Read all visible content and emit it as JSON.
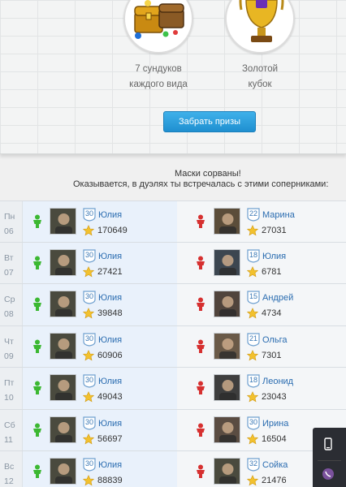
{
  "prizes": {
    "chests": {
      "line1": "7 сундуков",
      "line2": "каждого вида",
      "icon": "treasure-chests-icon"
    },
    "cup": {
      "line1": "Золотой",
      "line2": "кубок",
      "icon": "golden-cup-icon"
    }
  },
  "claim_button": "Забрать призы",
  "message": {
    "title": "Маски сорваны!",
    "subtitle": "Оказывается, в дуэлях ты встречалась с этими соперниками:"
  },
  "colors": {
    "accent_blue": "#2a99dc",
    "name_link": "#2a6cb0",
    "winner_green": "#3cb832",
    "loser_red": "#d63030",
    "star_gold": "#f2c12e"
  },
  "duels": [
    {
      "day": "Пн",
      "date": "06",
      "left": {
        "level": "30",
        "name": "Юлия",
        "score": "170649",
        "result": "win"
      },
      "right": {
        "level": "22",
        "name": "Марина",
        "score": "27031",
        "result": "lose"
      }
    },
    {
      "day": "Вт",
      "date": "07",
      "left": {
        "level": "30",
        "name": "Юлия",
        "score": "27421",
        "result": "win"
      },
      "right": {
        "level": "18",
        "name": "Юлия",
        "score": "6781",
        "result": "lose"
      }
    },
    {
      "day": "Ср",
      "date": "08",
      "left": {
        "level": "30",
        "name": "Юлия",
        "score": "39848",
        "result": "win"
      },
      "right": {
        "level": "15",
        "name": "Андрей",
        "score": "4734",
        "result": "lose"
      }
    },
    {
      "day": "Чт",
      "date": "09",
      "left": {
        "level": "30",
        "name": "Юлия",
        "score": "60906",
        "result": "win"
      },
      "right": {
        "level": "21",
        "name": "Ольга",
        "score": "7301",
        "result": "lose"
      }
    },
    {
      "day": "Пт",
      "date": "10",
      "left": {
        "level": "30",
        "name": "Юлия",
        "score": "49043",
        "result": "win"
      },
      "right": {
        "level": "18",
        "name": "Леонид",
        "score": "23043",
        "result": "lose"
      }
    },
    {
      "day": "Сб",
      "date": "11",
      "left": {
        "level": "30",
        "name": "Юлия",
        "score": "56697",
        "result": "win"
      },
      "right": {
        "level": "30",
        "name": "Ирина",
        "score": "16504",
        "result": "lose"
      }
    },
    {
      "day": "Вс",
      "date": "12",
      "left": {
        "level": "30",
        "name": "Юлия",
        "score": "88839",
        "result": "win"
      },
      "right": {
        "level": "32",
        "name": "Сойка",
        "score": "21476",
        "result": "lose"
      }
    }
  ],
  "side_widget": {
    "top_icon": "phone-icon",
    "bottom_icon": "viber-icon"
  }
}
